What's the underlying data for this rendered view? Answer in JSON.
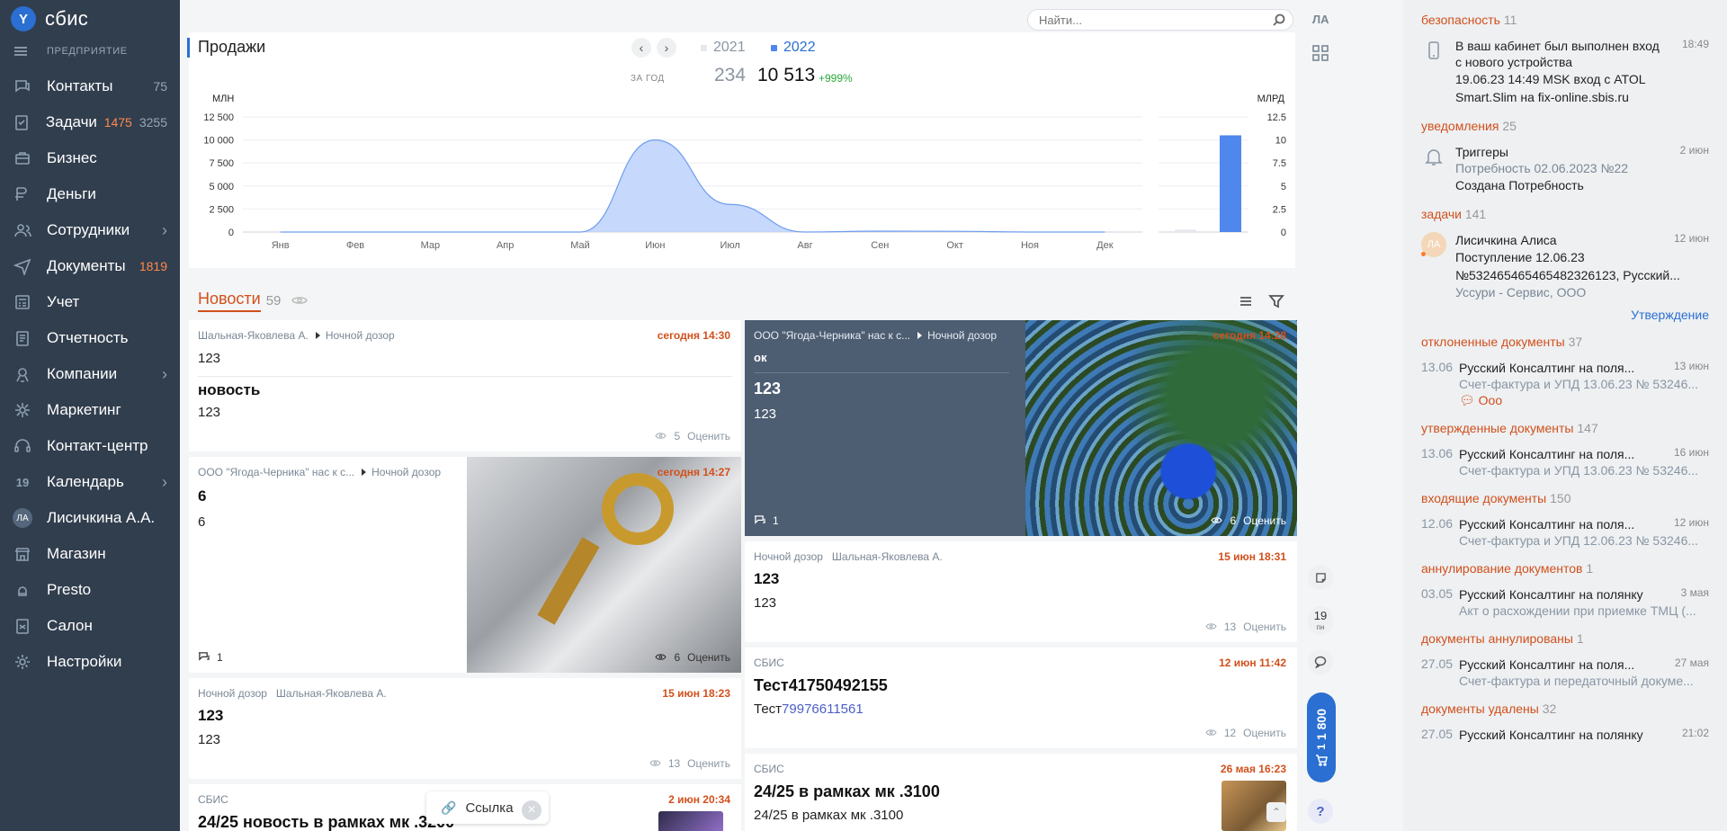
{
  "sidebar": {
    "logo_mark": "Y",
    "logo_text": "сбис",
    "org_label": "ПРЕДПРИЯТИЕ",
    "items": [
      {
        "label": "Контакты",
        "count": "75"
      },
      {
        "label": "Задачи",
        "count": "1475",
        "count2": "3255"
      },
      {
        "label": "Бизнес"
      },
      {
        "label": "Деньги"
      },
      {
        "label": "Сотрудники"
      },
      {
        "label": "Документы",
        "count": "1819"
      },
      {
        "label": "Учет"
      },
      {
        "label": "Отчетность"
      },
      {
        "label": "Компании"
      },
      {
        "label": "Маркетинг"
      },
      {
        "label": "Контакт-центр"
      },
      {
        "label": "Календарь",
        "num": "19"
      },
      {
        "label": "Лисичкина А.А.",
        "avatar": "ЛА"
      },
      {
        "label": "Магазин"
      },
      {
        "label": "Presto"
      },
      {
        "label": "Салон"
      },
      {
        "label": "Настройки"
      }
    ]
  },
  "search": {
    "placeholder": "Найти..."
  },
  "rail": {
    "user_initials": "ЛА",
    "date_num": "19",
    "date_day": "пн",
    "cart_amount": "1 800",
    "cart_count": "1",
    "help": "?"
  },
  "sales": {
    "title": "Продажи",
    "years": [
      "2021",
      "2022"
    ],
    "per_year_label": "ЗА ГОД",
    "value_2021": "234",
    "value_2022": "10 513",
    "delta": "+999%",
    "unit_left": "МЛН",
    "unit_right": "МЛРД"
  },
  "chart_data": {
    "type": "area",
    "title": "Продажи",
    "categories": [
      "Янв",
      "Фев",
      "Мар",
      "Апр",
      "Май",
      "Июн",
      "Июл",
      "Авг",
      "Сен",
      "Окт",
      "Ноя",
      "Дек"
    ],
    "series": [
      {
        "name": "2022",
        "values": [
          0,
          0,
          0,
          0,
          0,
          10000,
          3000,
          0,
          100,
          80,
          0,
          0
        ]
      }
    ],
    "y_ticks": [
      "0",
      "2 500",
      "5 000",
      "7 500",
      "10 000",
      "12 500"
    ],
    "ylim": [
      0,
      12500
    ],
    "ylabel": "МЛН",
    "right_chart": {
      "type": "bar",
      "ylabel": "МЛРД",
      "y_ticks": [
        "0",
        "2.5",
        "5",
        "7.5",
        "10",
        "12.5"
      ],
      "ylim": [
        0,
        12.5
      ],
      "series": [
        {
          "name": "2021",
          "value": 0.23
        },
        {
          "name": "2022",
          "value": 10.5
        }
      ]
    },
    "colors": {
      "area": "#bcd2fb",
      "line": "#6f9df0",
      "bar": "#4f87ec",
      "bar_prev": "#e6e8eb"
    }
  },
  "news": {
    "title": "Новости",
    "count": "59",
    "cards": [
      {
        "author": "Шальная-Яковлева А.",
        "channel": "Ночной дозор",
        "date": "сегодня 14:30",
        "lead": "123",
        "title": "новость",
        "text": "123",
        "views": "5",
        "rate": "Оценить"
      },
      {
        "author": "ООО \"Ягода-Черника\" нас к с...",
        "channel": "Ночной дозор",
        "date": "сегодня 14:27",
        "title": "6",
        "text": "6",
        "comments": "1",
        "views": "6",
        "rate": "Оценить"
      },
      {
        "author": "Ночной дозор",
        "channel": "Шальная-Яковлева А.",
        "date": "15 июн 18:23",
        "title": "123",
        "text": "123",
        "views": "13",
        "rate": "Оценить"
      },
      {
        "author": "СБИС",
        "date": "2 июн 20:34",
        "title": "24/25 новость в рамках мк .3200"
      },
      {
        "author": "ООО \"Ягода-Черника\" нас к с...",
        "channel": "Ночной дозор",
        "date": "сегодня 14:28",
        "lead": "ок",
        "title": "123",
        "text": "123",
        "comments": "1",
        "views": "6",
        "rate": "Оценить"
      },
      {
        "author": "Ночной дозор",
        "channel": "Шальная-Яковлева А.",
        "date": "15 июн 18:31",
        "title": "123",
        "text": "123",
        "views": "13",
        "rate": "Оценить"
      },
      {
        "author": "СБИС",
        "date": "12 июн 11:42",
        "title": "Тест41750492155",
        "text_prefix": "Тест",
        "text_link": "79976611561",
        "views": "12",
        "rate": "Оценить"
      },
      {
        "author": "СБИС",
        "date": "26 мая 16:23",
        "title": "24/25 в рамках мк .3100",
        "text": "24/25 в рамках мк .3100"
      }
    ]
  },
  "link_tooltip": {
    "label": "Ссылка"
  },
  "events": {
    "sections": [
      {
        "name": "безопасность",
        "count": "11"
      },
      {
        "name": "уведомления",
        "count": "25"
      },
      {
        "name": "задачи",
        "count": "141"
      },
      {
        "name": "отклоненные документы",
        "count": "37"
      },
      {
        "name": "утвержденные документы",
        "count": "147"
      },
      {
        "name": "входящие документы",
        "count": "150"
      },
      {
        "name": "аннулирование документов",
        "count": "1"
      },
      {
        "name": "документы аннулированы",
        "count": "1"
      },
      {
        "name": "документы удалены",
        "count": "32"
      }
    ],
    "security": {
      "title": "В ваш кабинет был выполнен вход с нового устройства",
      "time": "18:49",
      "detail1": "19.06.23 14:49 MSK вход с ATOL",
      "detail2": "Smart.Slim на fix-online.sbis.ru"
    },
    "notification": {
      "title": "Триггеры",
      "time": "2 июн",
      "sub": "Потребность 02.06.2023 №22",
      "line": "Создана Потребность"
    },
    "task": {
      "avatar": "ЛА",
      "title": "Лисичкина Алиса",
      "time": "12 июн",
      "line1": "Поступление 12.06.23",
      "line2": "№532465465465482326123, Русский...",
      "sub": "Уссури - Сервис, ООО",
      "action": "Утверждение"
    },
    "docs": [
      {
        "date": "13.06",
        "title": "Русский Консалтинг на поля...",
        "time": "13 июн",
        "sub": "Счет-фактура и УПД 13.06.23 № 53246...",
        "comment": "Ооо"
      },
      {
        "date": "13.06",
        "title": "Русский Консалтинг на поля...",
        "time": "16 июн",
        "sub": "Счет-фактура и УПД 13.06.23 № 53246..."
      },
      {
        "date": "12.06",
        "title": "Русский Консалтинг на поля...",
        "time": "12 июн",
        "sub": "Счет-фактура и УПД 12.06.23 № 53246..."
      },
      {
        "date": "03.05",
        "title": "Русский Консалтинг на полянку",
        "time": "3 мая",
        "sub": "Акт о расхождении при приемке ТМЦ (..."
      },
      {
        "date": "27.05",
        "title": "Русский Консалтинг на поля...",
        "time": "27 мая",
        "sub": "Счет-фактура и передаточный докуме..."
      },
      {
        "date": "27.05",
        "title": "Русский Консалтинг на полянку",
        "time": "21:02"
      }
    ]
  }
}
